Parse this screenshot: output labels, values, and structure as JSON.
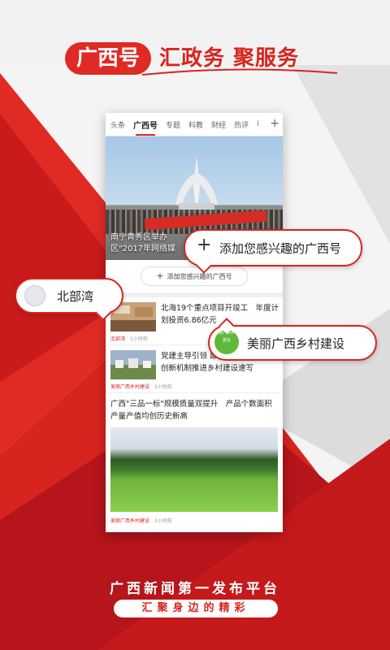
{
  "colors": {
    "brand_red": "#e02a25",
    "dark_red": "#b5151b",
    "bg_gray": "#f2f2f2"
  },
  "headline": {
    "pill": "广西号",
    "rest": "汇政务 聚服务"
  },
  "tabs": [
    {
      "label": "头条"
    },
    {
      "label": "广西号",
      "active": true
    },
    {
      "label": "专题"
    },
    {
      "label": "科教"
    },
    {
      "label": "财经"
    },
    {
      "label": "热评"
    },
    {
      "label": "i"
    }
  ],
  "tabs_plus_icon": "plus-icon",
  "hero": {
    "caption_line1": "南宁青秀区举办",
    "caption_line2": "区\"2017年网络媒"
  },
  "add_button": {
    "icon": "plus-icon",
    "label": "添加您感兴趣的广西号"
  },
  "news": [
    {
      "title": "北海19个重点项目开竣工　年度计划投资6.86亿元",
      "source": "北部湾",
      "time": "1小时前"
    },
    {
      "title": "党建主导引领 部门合力攻坚浦北县创新机制推进乡村建设速写",
      "source": "美丽广西乡村建设",
      "time": "2小时前"
    }
  ],
  "big_news": {
    "title": "广西\"三品一标\"规模质量双提升　产品个数面积产量产值均创历史新高",
    "source": "美丽广西乡村建设",
    "time": "2小时前"
  },
  "callouts": {
    "add": {
      "icon": "plus-icon",
      "label": "添加您感兴趣的广西号"
    },
    "beibuwan": {
      "label": "北部湾"
    },
    "village": {
      "label": "美丽广西乡村建设",
      "avatar_text": "美丽广西乡村建设"
    }
  },
  "footer": {
    "slogan1": "广西新闻第一发布平台",
    "slogan2": "汇聚身边的精彩"
  }
}
